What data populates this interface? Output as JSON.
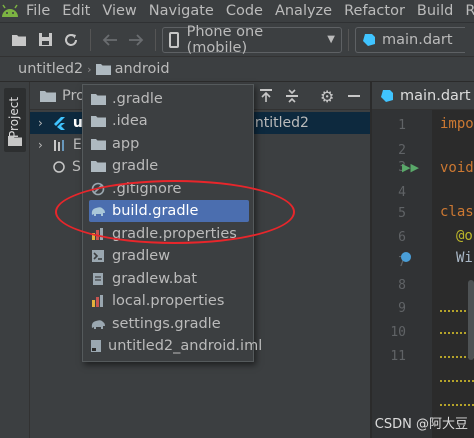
{
  "menubar": {
    "items": [
      "File",
      "Edit",
      "View",
      "Navigate",
      "Code",
      "Analyze",
      "Refactor",
      "Build",
      "Run"
    ]
  },
  "toolbar": {
    "device_label": "Phone one (mobile)",
    "run_config_label": "main.dart"
  },
  "breadcrumb": {
    "project": "untitled2",
    "folder": "android"
  },
  "stripe": {
    "project_tab": "Project"
  },
  "project_panel": {
    "header_label": "Pro",
    "rows": [
      {
        "prefix": "u",
        "suffix": "untitled2"
      },
      {
        "prefix": "E"
      },
      {
        "prefix": "S"
      }
    ]
  },
  "editor": {
    "tab_label": "main.dart",
    "line_numbers": [
      "1",
      "2",
      "3",
      "4",
      "5",
      "6",
      "7",
      "8",
      "9",
      "10",
      "11"
    ],
    "code_lines": [
      "impo",
      "void",
      "clas",
      "@o",
      "Wi"
    ]
  },
  "popup": {
    "items": [
      {
        "label": ".gradle",
        "icon": "folder-icon"
      },
      {
        "label": ".idea",
        "icon": "folder-icon"
      },
      {
        "label": "app",
        "icon": "folder-icon"
      },
      {
        "label": "gradle",
        "icon": "folder-icon"
      },
      {
        "label": ".gitignore",
        "icon": "gitignore-icon"
      },
      {
        "label": "build.gradle",
        "icon": "gradle-elephant-icon"
      },
      {
        "label": "gradle.properties",
        "icon": "properties-icon"
      },
      {
        "label": "gradlew",
        "icon": "script-icon"
      },
      {
        "label": "gradlew.bat",
        "icon": "bat-file-icon"
      },
      {
        "label": "local.properties",
        "icon": "properties-icon"
      },
      {
        "label": "settings.gradle",
        "icon": "gradle-elephant-icon"
      },
      {
        "label": "untitled2_android.iml",
        "icon": "iml-file-icon"
      }
    ],
    "selected_index": 5
  },
  "watermark": "CSDN @阿大豆",
  "colors": {
    "accent": "#4b6eaf",
    "annotation": "#e8262b",
    "background": "#2b2b2b",
    "panel": "#3c3f41"
  }
}
